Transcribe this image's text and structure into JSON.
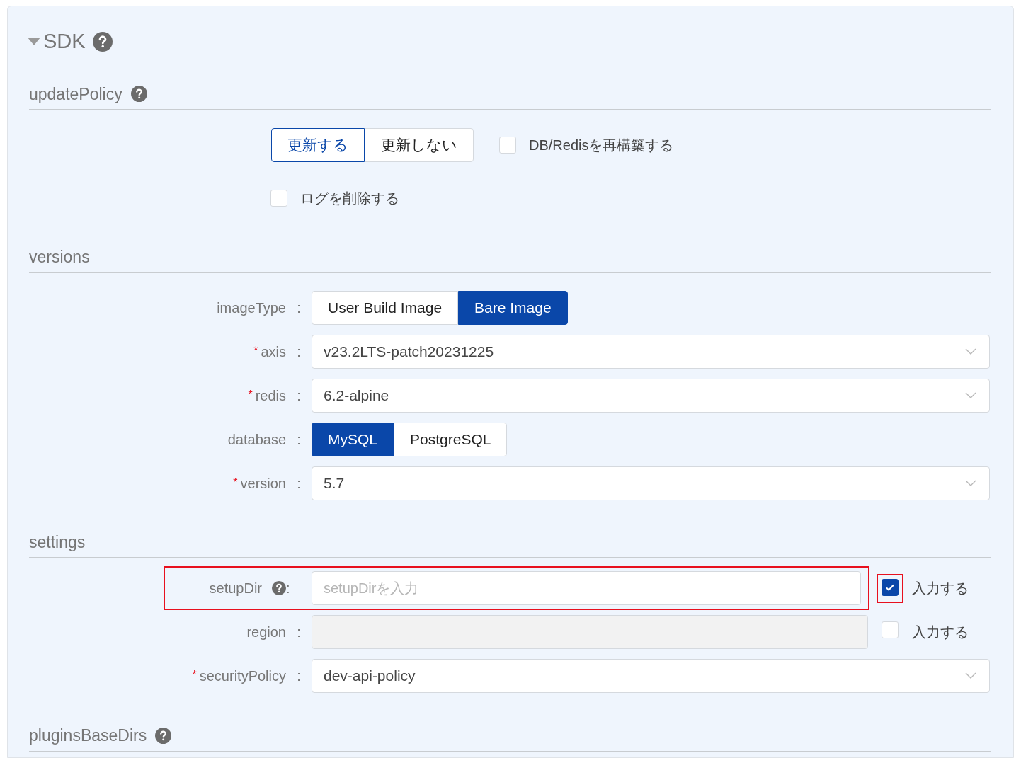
{
  "section": {
    "title": "SDK",
    "expanded": true,
    "help": true
  },
  "update_policy": {
    "title": "updatePolicy",
    "help": true,
    "options": [
      {
        "label": "更新する",
        "selected": true
      },
      {
        "label": "更新しない",
        "selected": false
      }
    ],
    "checkboxes": [
      {
        "label": "DB/Redisを再構築する",
        "checked": false
      },
      {
        "label": "ログを削除する",
        "checked": false
      }
    ]
  },
  "versions": {
    "title": "versions",
    "fields": [
      {
        "kind": "segmented",
        "label": "imageType",
        "colon": ":",
        "options": [
          {
            "label": "User Build Image",
            "selected": false
          },
          {
            "label": "Bare Image",
            "selected": true
          }
        ]
      },
      {
        "kind": "select",
        "label": "axis",
        "colon": ":",
        "required_mark": "*",
        "value": "v23.2LTS-patch20231225"
      },
      {
        "kind": "select",
        "label": "redis",
        "colon": ":",
        "required_mark": "*",
        "value": "6.2-alpine"
      },
      {
        "kind": "segmented",
        "label": "database",
        "colon": ":",
        "options": [
          {
            "label": "MySQL",
            "selected": true
          },
          {
            "label": "PostgreSQL",
            "selected": false
          }
        ]
      },
      {
        "kind": "select",
        "label": "version",
        "colon": ":",
        "required_mark": "*",
        "value": "5.7"
      }
    ]
  },
  "settings": {
    "title": "settings",
    "fields": [
      {
        "kind": "text",
        "label": "setupDir",
        "colon": ":",
        "help": true,
        "placeholder": "setupDirを入力",
        "disabled": false,
        "highlighted": true,
        "toggle": {
          "label": "入力する",
          "checked": true,
          "highlighted": true
        }
      },
      {
        "kind": "text",
        "label": "region",
        "colon": ":",
        "disabled": true,
        "highlighted": false,
        "toggle": {
          "label": "入力する",
          "checked": false,
          "highlighted": false
        }
      },
      {
        "kind": "select",
        "label": "securityPolicy",
        "colon": ":",
        "required_mark": "*",
        "value": "dev-api-policy"
      }
    ]
  },
  "plugins_base_dirs": {
    "title": "pluginsBaseDirs",
    "help": true
  }
}
